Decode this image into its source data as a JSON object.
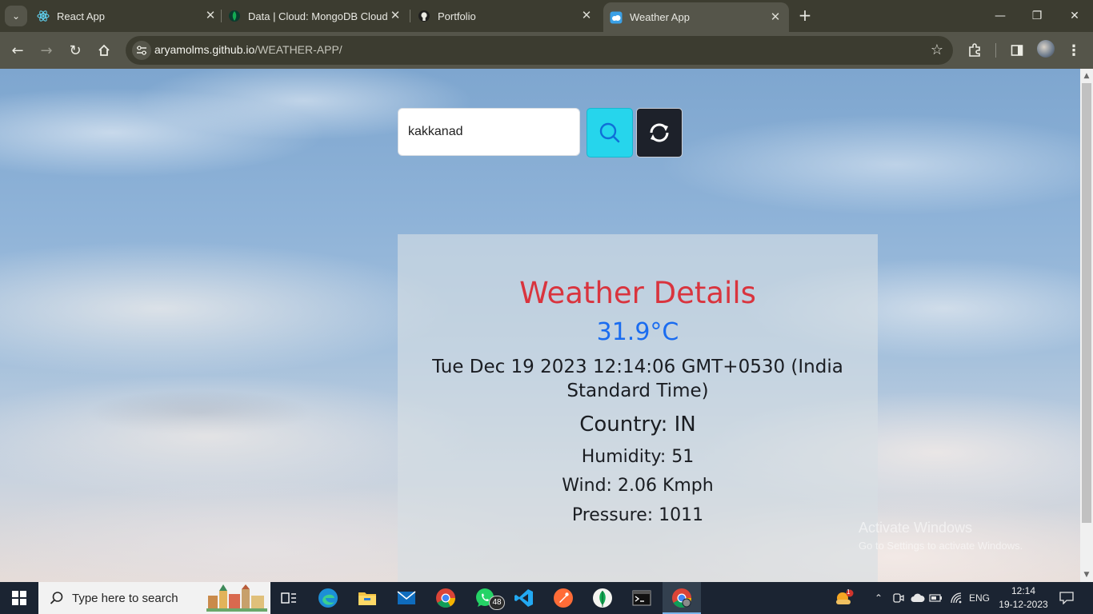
{
  "browser": {
    "tabs": [
      {
        "label": "React App",
        "icon": "react-icon"
      },
      {
        "label": "Data | Cloud: MongoDB Cloud",
        "icon": "mongodb-leaf-icon"
      },
      {
        "label": "Portfolio",
        "icon": "github-icon"
      },
      {
        "label": "Weather App",
        "icon": "weather-app-icon",
        "active": true
      }
    ],
    "url_host": "aryamolms.github.io",
    "url_path": "/WEATHER-APP/"
  },
  "app": {
    "search_value": "kakkanad",
    "search_button_color": "#26d5ec",
    "refresh_button_color": "#1d212a"
  },
  "weather": {
    "title": "Weather Details",
    "temperature": "31.9°C",
    "datetime": "Tue Dec 19 2023 12:14:06 GMT+0530 (India Standard Time)",
    "country": "Country: IN",
    "humidity": "Humidity: 51",
    "wind": "Wind: 2.06 Kmph",
    "pressure": "Pressure: 1011",
    "title_color": "#d9343e",
    "temperature_color": "#1a6cf0"
  },
  "watermark": {
    "line1": "Activate Windows",
    "line2": "Go to Settings to activate Windows."
  },
  "taskbar": {
    "search_placeholder": "Type here to search",
    "whatsapp_badge": "48",
    "weather_badge": "1",
    "language": "ENG",
    "time": "12:14",
    "date": "19-12-2023"
  }
}
